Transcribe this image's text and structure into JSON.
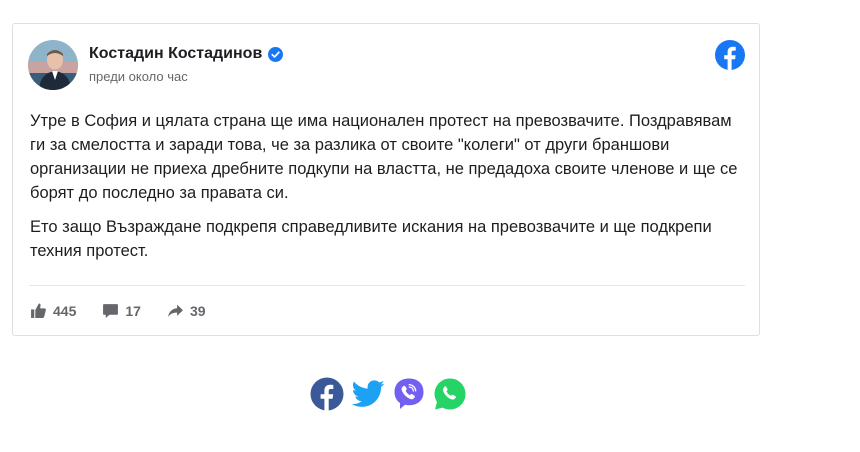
{
  "post": {
    "author_name": "Костадин Костадинов",
    "timestamp": "преди около час",
    "paragraphs": [
      "Утре в София и цялата страна ще има национален протест на превозвачите. Поздравявам ги за смелостта и заради това, че за разлика от своите \"колеги\" от други браншови организации не приеха дребните подкупи на властта, не предадоха своите членове и ще се борят до последно за правата си.",
      "Ето защо Възраждане подкрепя справедливите искания на превозвачите и ще подкрепи техния протест."
    ],
    "stats": {
      "likes": "445",
      "comments": "17",
      "shares": "39"
    }
  },
  "icons": {
    "verified": "verified-badge-icon",
    "platform": "facebook-logo-icon",
    "like": "thumbs-up-icon",
    "comment": "comment-icon",
    "share": "share-arrow-icon"
  },
  "share_buttons": [
    "facebook",
    "twitter",
    "viber",
    "whatsapp"
  ],
  "colors": {
    "facebook": "#1877f2",
    "facebook_share": "#3b5998",
    "twitter": "#1da1f2",
    "viber": "#7360f2",
    "whatsapp": "#25d366",
    "verified": "#1877f2",
    "muted_text": "#65676b"
  }
}
